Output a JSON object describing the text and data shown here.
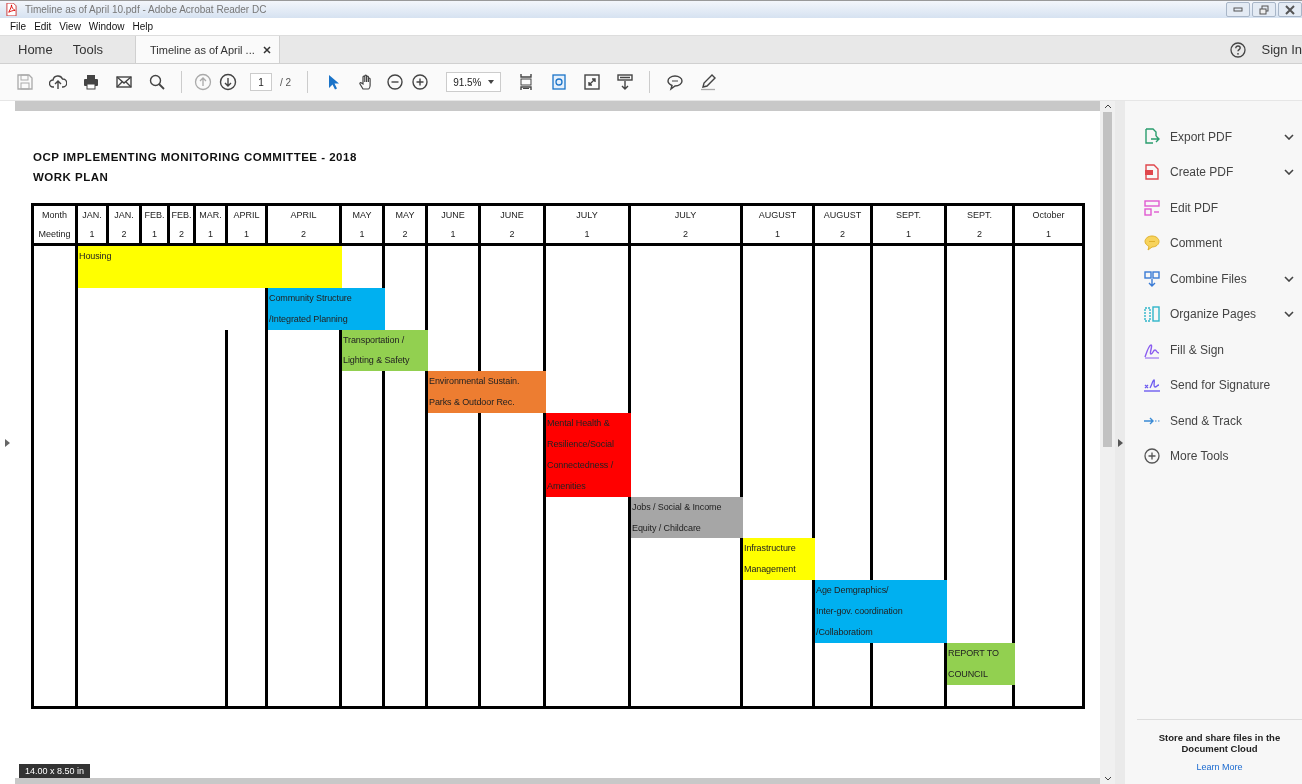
{
  "window": {
    "title": "Timeline as of April 10.pdf - Adobe Acrobat Reader DC"
  },
  "menu": [
    "File",
    "Edit",
    "View",
    "Window",
    "Help"
  ],
  "tabs": [
    {
      "label": "Home",
      "selected": false
    },
    {
      "label": "Tools",
      "selected": false
    },
    {
      "label": "Timeline as of April ...",
      "selected": true,
      "closable": true
    }
  ],
  "account": {
    "label": "Sign In"
  },
  "toolbar": {
    "page": "1",
    "page_total": "/ 2",
    "zoom": "91.5%"
  },
  "document": {
    "title": "OCP IMPLEMENTING MONITORING COMMITTEE  -  2018",
    "subtitle": "WORK PLAN",
    "columns": [
      {
        "month": "Month",
        "number": "Meeting"
      },
      {
        "month": "JAN.",
        "number": "1"
      },
      {
        "month": "JAN.",
        "number": "2"
      },
      {
        "month": "FEB.",
        "number": "1"
      },
      {
        "month": "FEB.",
        "number": "2"
      },
      {
        "month": "MAR.",
        "number": "1"
      },
      {
        "month": "APRIL",
        "number": "1"
      },
      {
        "month": "APRIL",
        "number": "2"
      },
      {
        "month": "MAY",
        "number": "1"
      },
      {
        "month": "MAY",
        "number": "2"
      },
      {
        "month": "JUNE",
        "number": "1"
      },
      {
        "month": "JUNE",
        "number": "2"
      },
      {
        "month": "JULY",
        "number": "1"
      },
      {
        "month": "JULY",
        "number": "2"
      },
      {
        "month": "AUGUST",
        "number": "1"
      },
      {
        "month": "AUGUST",
        "number": "2"
      },
      {
        "month": "SEPT.",
        "number": "1"
      },
      {
        "month": "SEPT.",
        "number": "2"
      },
      {
        "month": "October",
        "number": "1"
      }
    ],
    "tasks": [
      {
        "text": "Housing",
        "color": "#ffff00"
      },
      {
        "text": "Community Structure\n/Integrated Planning",
        "color": "#00b0f0"
      },
      {
        "text": "Transportation /\nLighting & Safety",
        "color": "#92d050"
      },
      {
        "text": "Environmental Sustain.\nParks & Outdoor Rec.",
        "color": "#ed7d31"
      },
      {
        "text": "Mental Health &\nResilience/Social\nConnectedness /\nAmenities",
        "color": "#ff0000"
      },
      {
        "text": "Jobs / Social & Income\nEquity / Childcare",
        "color": "#a6a6a6"
      },
      {
        "text": "Infrastructure\nManagement",
        "color": "#ffff00"
      },
      {
        "text": "Age Demgraphics/\nInter-gov. coordination\n/Collaboratiom",
        "color": "#00b0f0"
      },
      {
        "text": "REPORT TO\nCOUNCIL",
        "color": "#92d050"
      }
    ],
    "page_size": "14.00 x 8.50 in"
  },
  "tools": [
    {
      "label": "Export PDF",
      "has_menu": true
    },
    {
      "label": "Create PDF",
      "has_menu": true
    },
    {
      "label": "Edit PDF",
      "has_menu": false
    },
    {
      "label": "Comment",
      "has_menu": false
    },
    {
      "label": "Combine Files",
      "has_menu": true
    },
    {
      "label": "Organize Pages",
      "has_menu": true
    },
    {
      "label": "Fill & Sign",
      "has_menu": false
    },
    {
      "label": "Send for Signature",
      "has_menu": false
    },
    {
      "label": "Send & Track",
      "has_menu": false
    },
    {
      "label": "More Tools",
      "has_menu": false
    }
  ],
  "cloud": {
    "text": "Store and share files in the Document Cloud",
    "link": "Learn More"
  }
}
